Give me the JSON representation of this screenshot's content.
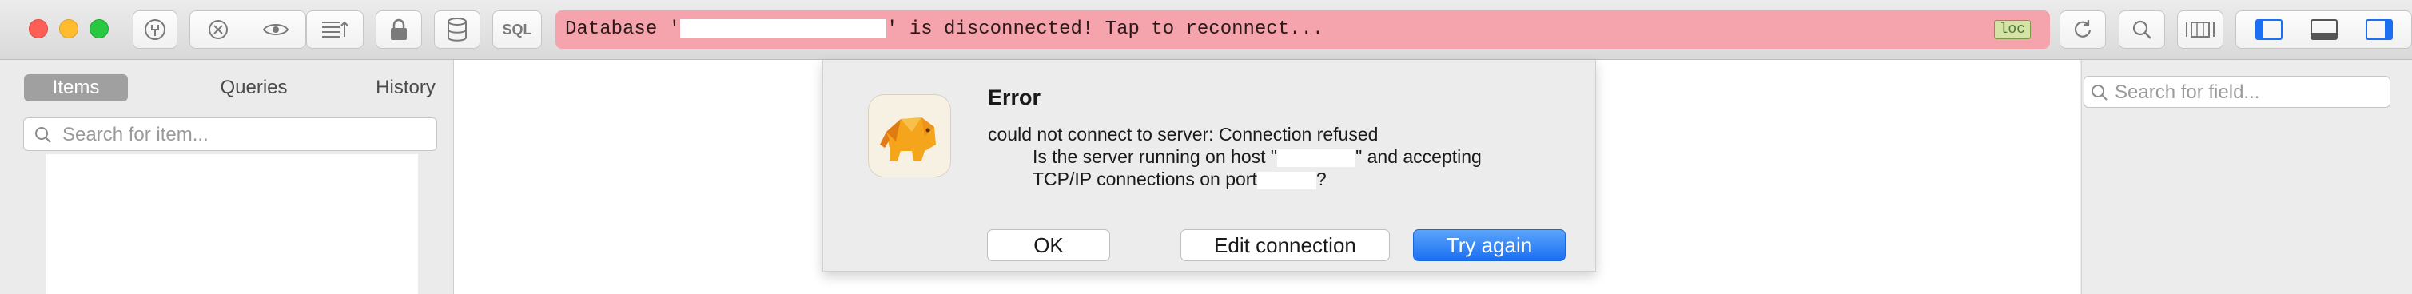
{
  "toolbar": {
    "sql_label": "SQL",
    "banner_before": "Database '",
    "banner_after": "' is disconnected! Tap to reconnect...",
    "loc_badge": "loc",
    "banner_color": "#f5a3ac"
  },
  "sidebar": {
    "tabs": [
      {
        "label": "Items",
        "active": true
      },
      {
        "label": "Queries",
        "active": false
      },
      {
        "label": "History",
        "active": false
      }
    ],
    "search_placeholder": "Search for item..."
  },
  "right_panel": {
    "search_placeholder": "Search for field..."
  },
  "dialog": {
    "title": "Error",
    "line1": "could not connect to server: Connection refused",
    "line2_before": "Is the server running on host \"",
    "line2_after": "\" and accepting",
    "line3_before": "TCP/IP connections on port",
    "line3_after": "?",
    "buttons": {
      "ok": "OK",
      "edit": "Edit connection",
      "retry": "Try again"
    },
    "primary_color": "#1a6ff2"
  },
  "icons": [
    "close-traffic-light-icon",
    "minimize-traffic-light-icon",
    "zoom-traffic-light-icon",
    "connection-plug-icon",
    "stop-icon",
    "eye-icon",
    "sort-rows-icon",
    "lock-icon",
    "database-icon",
    "refresh-icon",
    "search-icon",
    "columns-view-icon",
    "left-panel-icon",
    "bottom-panel-icon",
    "right-panel-icon",
    "elephant-app-icon"
  ]
}
